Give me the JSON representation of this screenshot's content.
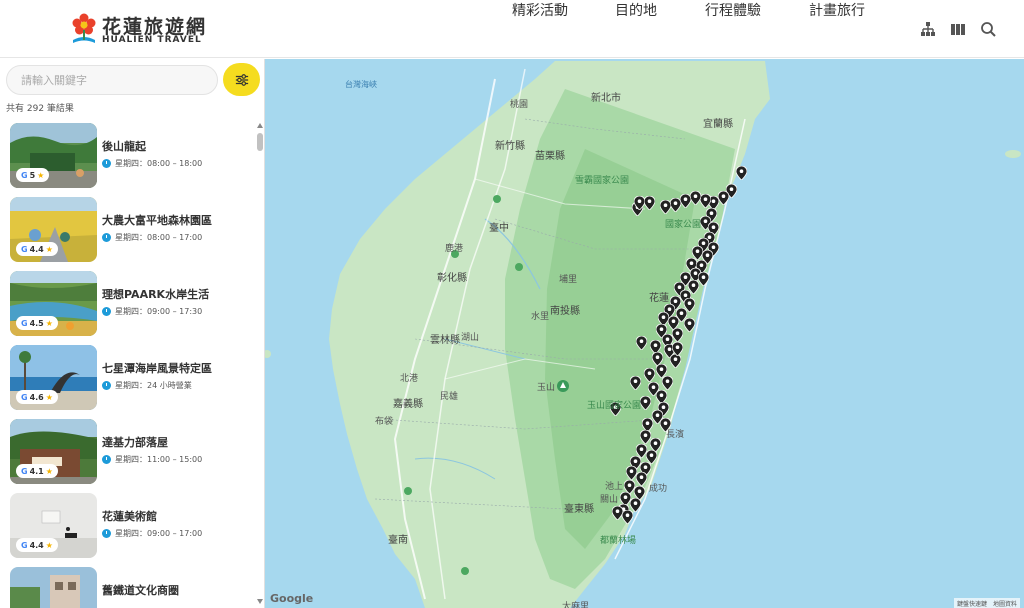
{
  "header": {
    "logo_zh": "花蓮旅遊網",
    "logo_en": "HUALIEN TRAVEL",
    "nav": [
      {
        "label": "精彩活動"
      },
      {
        "label": "目的地"
      },
      {
        "label": "行程體驗"
      },
      {
        "label": "計畫旅行"
      }
    ],
    "icons": [
      "sitemap-icon",
      "map-grid-icon",
      "search-icon"
    ]
  },
  "sidebar": {
    "search_placeholder": "請輸入關鍵字",
    "filter_icon": "filter-sliders-icon",
    "result_count": "共有 292 筆結果",
    "items": [
      {
        "title": "後山龍起",
        "rating": "5",
        "hours": "星期四：08:00 – 18:00"
      },
      {
        "title": "大農大富平地森林園區",
        "rating": "4.4",
        "hours": "星期四：08:00 – 17:00"
      },
      {
        "title": "理想PAARK水岸生活",
        "rating": "4.5",
        "hours": "星期四：09:00 – 17:30"
      },
      {
        "title": "七星潭海岸風景特定區",
        "rating": "4.6",
        "hours": "星期四：24 小時營業"
      },
      {
        "title": "達基力部落屋",
        "rating": "4.1",
        "hours": "星期四：11:00 – 15:00"
      },
      {
        "title": "花蓮美術館",
        "rating": "4.4",
        "hours": "星期四：09:00 – 17:00"
      },
      {
        "title": "舊鐵道文化商圈",
        "rating": "",
        "hours": ""
      }
    ]
  },
  "map": {
    "labels": {
      "xinbei": "新北市",
      "taoyuan": "桃園",
      "xinzhu": "新竹縣",
      "yilan": "宜蘭縣",
      "miaoli": "苗栗縣",
      "xueba": "雪霸國家公園",
      "taichung": "臺中",
      "changhua": "彰化縣",
      "nantou": "南投縣",
      "yunlin": "雲林縣",
      "chiayi": "嘉義縣",
      "yushan": "玉山",
      "yushan_park": "玉山國家公園",
      "hualien": "花蓮",
      "tainan": "臺南",
      "taitung": "臺東縣",
      "dulan": "都蘭林場",
      "strait": "台灣海峽",
      "chishang": "池上",
      "guanshan": "關山",
      "chenggong": "成功",
      "changbin": "長濱",
      "taroko": "國家公園",
      "taima": "太麻里",
      "shuili": "水里",
      "lugang": "鹿港",
      "beigang": "北港",
      "budai": "布袋",
      "minxiong": "民雄",
      "puli": "埔里",
      "hushan": "湖山"
    },
    "google": "Google",
    "attribution": "鍵盤快速鍵　地圖資料"
  }
}
